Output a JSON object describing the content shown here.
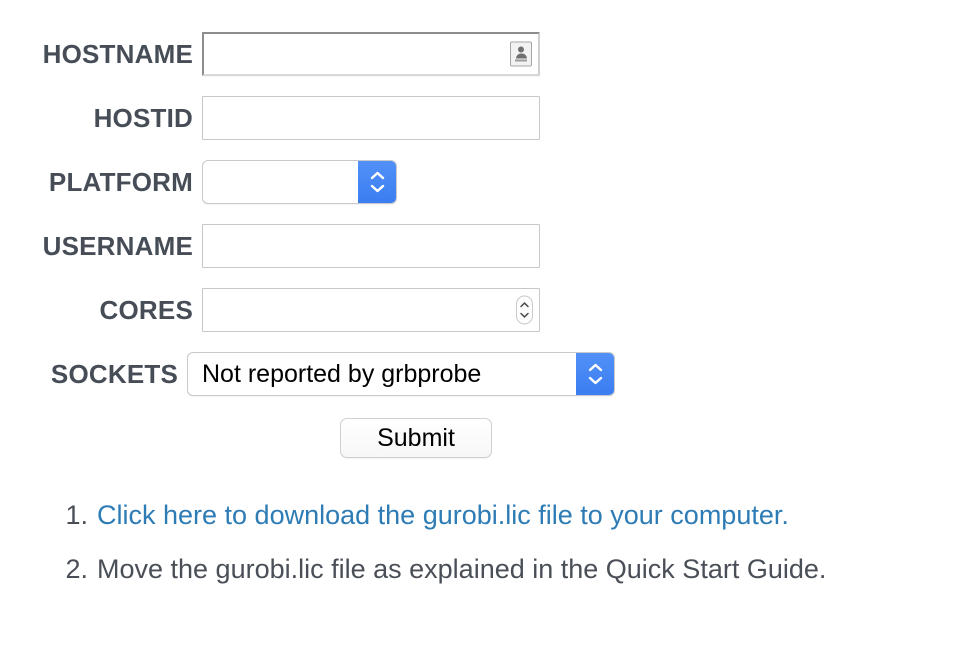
{
  "form": {
    "fields": [
      {
        "label": "HOSTNAME",
        "type": "text",
        "value": "",
        "placeholder": "",
        "icon": "contact-card-icon"
      },
      {
        "label": "HOSTID",
        "type": "text",
        "value": "",
        "placeholder": ""
      },
      {
        "label": "PLATFORM",
        "type": "select",
        "value": "",
        "icon": "chevron-up-down-icon"
      },
      {
        "label": "USERNAME",
        "type": "text",
        "value": "",
        "placeholder": ""
      },
      {
        "label": "CORES",
        "type": "number",
        "value": "",
        "placeholder": "",
        "icon": "stepper-up-down-icon"
      },
      {
        "label": "SOCKETS",
        "type": "select",
        "value": "Not reported by grbprobe",
        "icon": "chevron-up-down-icon"
      }
    ],
    "submit_label": "Submit"
  },
  "steps": [
    {
      "marker": "1.",
      "text": "Click here to download the gurobi.lic file to your computer.",
      "is_link": true
    },
    {
      "marker": "2.",
      "text": "Move the gurobi.lic file as explained in the Quick Start Guide.",
      "is_link": false
    }
  ],
  "colors": {
    "label": "#474d57",
    "link": "#2d7cb5",
    "select_accent": "#3b7df2",
    "body_text": "#4a4f57",
    "background": "#ffffff"
  }
}
